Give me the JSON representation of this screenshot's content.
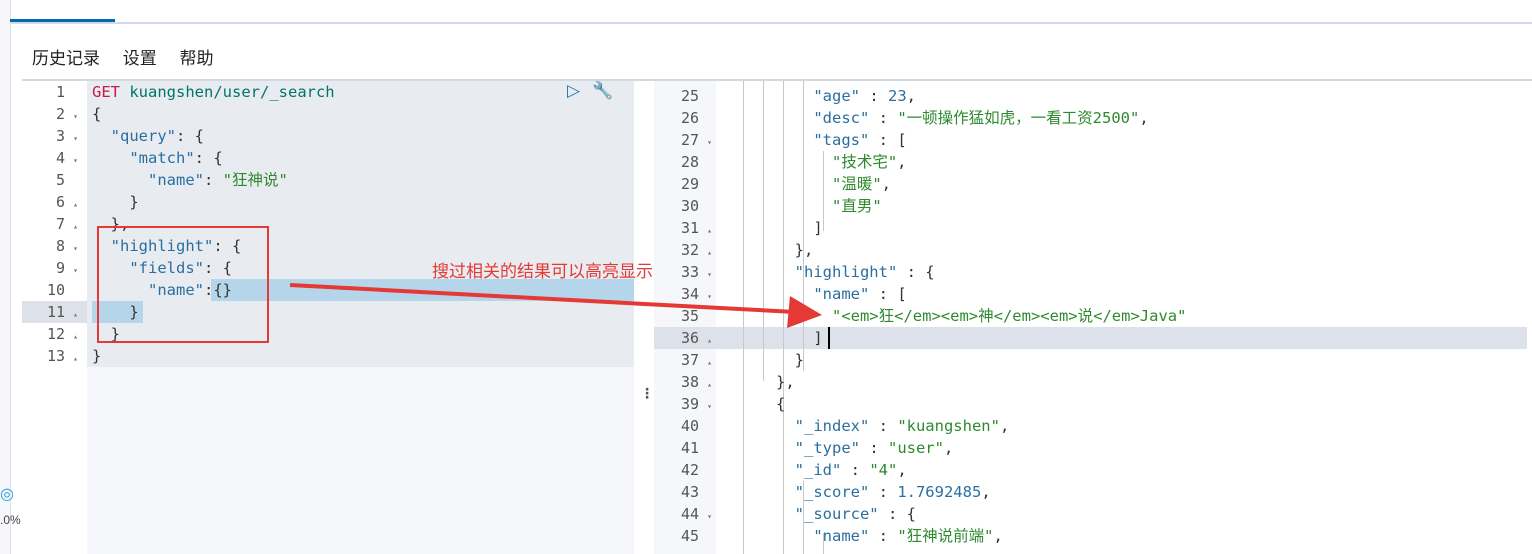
{
  "menu": {
    "items": [
      "历史记录",
      "设置",
      "帮助"
    ]
  },
  "annotation": {
    "text": "搜过相关的结果可以高亮显示",
    "color": "#e53935"
  },
  "status": {
    "zoom": ".0%"
  },
  "request": {
    "lines": [
      {
        "n": "1",
        "fold": "",
        "t": [
          [
            "m",
            "GET"
          ],
          [
            "p",
            " "
          ],
          [
            "u",
            "kuangshen/user/_search"
          ]
        ]
      },
      {
        "n": "2",
        "fold": "▾",
        "t": [
          [
            "p",
            "{"
          ]
        ]
      },
      {
        "n": "3",
        "fold": "▾",
        "t": [
          [
            "p",
            "  "
          ],
          [
            "k",
            "\"query\""
          ],
          [
            "p",
            ": {"
          ]
        ]
      },
      {
        "n": "4",
        "fold": "▾",
        "t": [
          [
            "p",
            "    "
          ],
          [
            "k",
            "\"match\""
          ],
          [
            "p",
            ": {"
          ]
        ]
      },
      {
        "n": "5",
        "fold": "",
        "t": [
          [
            "p",
            "      "
          ],
          [
            "k",
            "\"name\""
          ],
          [
            "p",
            ": "
          ],
          [
            "s",
            "\"狂神说\""
          ]
        ]
      },
      {
        "n": "6",
        "fold": "▴",
        "t": [
          [
            "p",
            "    }"
          ]
        ]
      },
      {
        "n": "7",
        "fold": "▴",
        "t": [
          [
            "p",
            "  },"
          ]
        ]
      },
      {
        "n": "8",
        "fold": "▾",
        "t": [
          [
            "p",
            "  "
          ],
          [
            "k",
            "\"highlight\""
          ],
          [
            "p",
            ": {"
          ]
        ]
      },
      {
        "n": "9",
        "fold": "▾",
        "t": [
          [
            "p",
            "    "
          ],
          [
            "k",
            "\"fields\""
          ],
          [
            "p",
            ": {"
          ]
        ]
      },
      {
        "n": "10",
        "fold": "",
        "t": [
          [
            "p",
            "      "
          ],
          [
            "k",
            "\"name\""
          ],
          [
            "p",
            ":{}"
          ]
        ]
      },
      {
        "n": "11",
        "fold": "▴",
        "t": [
          [
            "p",
            "    }"
          ]
        ]
      },
      {
        "n": "12",
        "fold": "▴",
        "t": [
          [
            "p",
            "  }"
          ]
        ]
      },
      {
        "n": "13",
        "fold": "▴",
        "t": [
          [
            "p",
            "}"
          ]
        ]
      }
    ]
  },
  "response": {
    "lines": [
      {
        "n": "25",
        "fold": "",
        "t": [
          [
            "p",
            "          "
          ],
          [
            "k",
            "\"age\""
          ],
          [
            "p",
            " : "
          ],
          [
            "n",
            "23"
          ],
          [
            "p",
            ","
          ]
        ]
      },
      {
        "n": "26",
        "fold": "",
        "t": [
          [
            "p",
            "          "
          ],
          [
            "k",
            "\"desc\""
          ],
          [
            "p",
            " : "
          ],
          [
            "s",
            "\"一顿操作猛如虎，一看工资2500\""
          ],
          [
            "p",
            ","
          ]
        ]
      },
      {
        "n": "27",
        "fold": "▾",
        "t": [
          [
            "p",
            "          "
          ],
          [
            "k",
            "\"tags\""
          ],
          [
            "p",
            " : ["
          ]
        ]
      },
      {
        "n": "28",
        "fold": "",
        "t": [
          [
            "p",
            "            "
          ],
          [
            "s",
            "\"技术宅\""
          ],
          [
            "p",
            ","
          ]
        ]
      },
      {
        "n": "29",
        "fold": "",
        "t": [
          [
            "p",
            "            "
          ],
          [
            "s",
            "\"温暖\""
          ],
          [
            "p",
            ","
          ]
        ]
      },
      {
        "n": "30",
        "fold": "",
        "t": [
          [
            "p",
            "            "
          ],
          [
            "s",
            "\"直男\""
          ]
        ]
      },
      {
        "n": "31",
        "fold": "▴",
        "t": [
          [
            "p",
            "          ]"
          ]
        ]
      },
      {
        "n": "32",
        "fold": "▴",
        "t": [
          [
            "p",
            "        },"
          ]
        ]
      },
      {
        "n": "33",
        "fold": "▾",
        "t": [
          [
            "p",
            "        "
          ],
          [
            "k",
            "\"highlight\""
          ],
          [
            "p",
            " : {"
          ]
        ]
      },
      {
        "n": "34",
        "fold": "▾",
        "t": [
          [
            "p",
            "          "
          ],
          [
            "k",
            "\"name\""
          ],
          [
            "p",
            " : ["
          ]
        ]
      },
      {
        "n": "35",
        "fold": "",
        "t": [
          [
            "p",
            "            "
          ],
          [
            "s",
            "\"<em>狂</em><em>神</em><em>说</em>Java\""
          ]
        ]
      },
      {
        "n": "36",
        "fold": "▴",
        "t": [
          [
            "p",
            "          ]"
          ]
        ]
      },
      {
        "n": "37",
        "fold": "▴",
        "t": [
          [
            "p",
            "        }"
          ]
        ]
      },
      {
        "n": "38",
        "fold": "▴",
        "t": [
          [
            "p",
            "      },"
          ]
        ]
      },
      {
        "n": "39",
        "fold": "▾",
        "t": [
          [
            "p",
            "      {"
          ]
        ]
      },
      {
        "n": "40",
        "fold": "",
        "t": [
          [
            "p",
            "        "
          ],
          [
            "k",
            "\"_index\""
          ],
          [
            "p",
            " : "
          ],
          [
            "s",
            "\"kuangshen\""
          ],
          [
            "p",
            ","
          ]
        ]
      },
      {
        "n": "41",
        "fold": "",
        "t": [
          [
            "p",
            "        "
          ],
          [
            "k",
            "\"_type\""
          ],
          [
            "p",
            " : "
          ],
          [
            "s",
            "\"user\""
          ],
          [
            "p",
            ","
          ]
        ]
      },
      {
        "n": "42",
        "fold": "",
        "t": [
          [
            "p",
            "        "
          ],
          [
            "k",
            "\"_id\""
          ],
          [
            "p",
            " : "
          ],
          [
            "s",
            "\"4\""
          ],
          [
            "p",
            ","
          ]
        ]
      },
      {
        "n": "43",
        "fold": "",
        "t": [
          [
            "p",
            "        "
          ],
          [
            "k",
            "\"_score\""
          ],
          [
            "p",
            " : "
          ],
          [
            "n",
            "1.7692485"
          ],
          [
            "p",
            ","
          ]
        ]
      },
      {
        "n": "44",
        "fold": "▾",
        "t": [
          [
            "p",
            "        "
          ],
          [
            "k",
            "\"_source\""
          ],
          [
            "p",
            " : {"
          ]
        ]
      },
      {
        "n": "45",
        "fold": "",
        "t": [
          [
            "p",
            "          "
          ],
          [
            "k",
            "\"name\""
          ],
          [
            "p",
            " : "
          ],
          [
            "s",
            "\"狂神说前端\""
          ],
          [
            "p",
            ","
          ]
        ]
      }
    ]
  }
}
